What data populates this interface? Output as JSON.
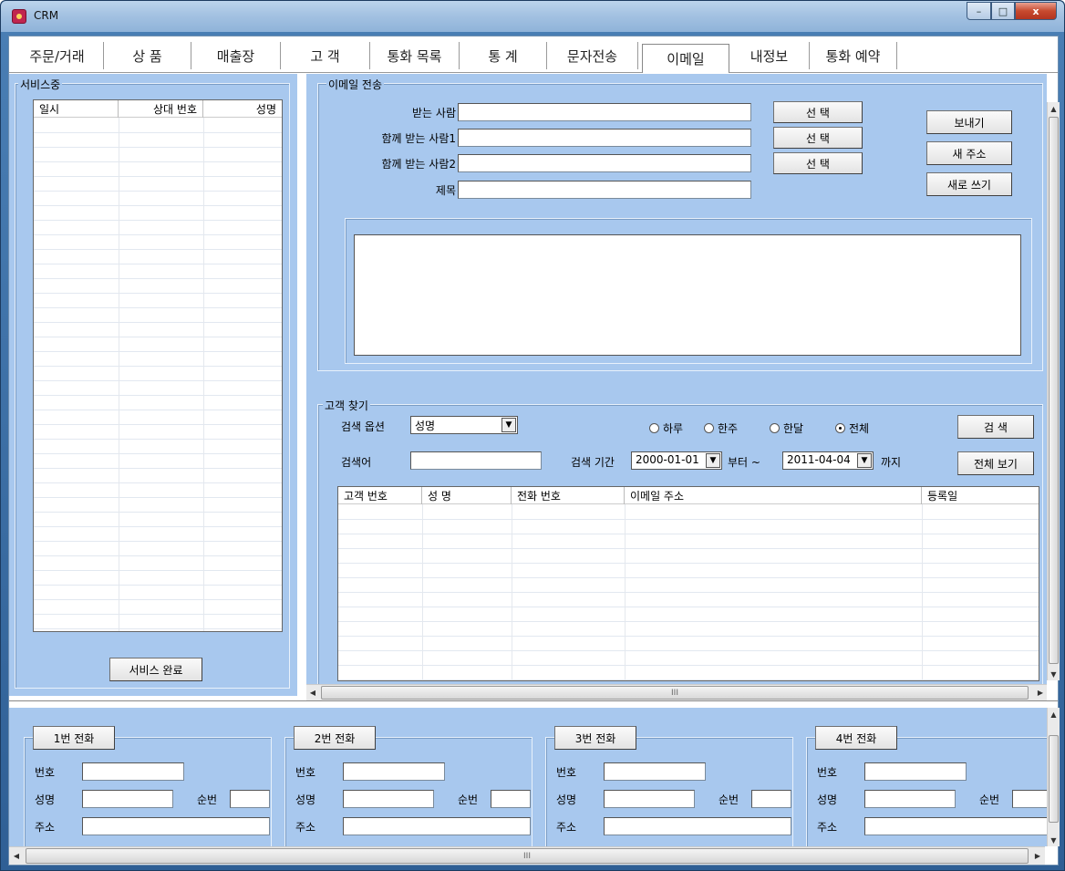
{
  "window": {
    "title": "CRM",
    "min": "–",
    "max": "□",
    "close": "x"
  },
  "tabs": [
    "주문/거래",
    "상 품",
    "매출장",
    "고 객",
    "통화 목록",
    "통 계",
    "문자전송",
    "이메일",
    "내정보",
    "통화 예약"
  ],
  "active_tab": "이메일",
  "service": {
    "group_label": "서비스중",
    "columns": [
      "일시",
      "상대 번호",
      "성명"
    ],
    "done_button": "서비스 완료"
  },
  "email": {
    "group_label": "이메일 전송",
    "to_label": "받는 사람",
    "cc1_label": "함께 받는 사람1",
    "cc2_label": "함께 받는 사람2",
    "subject_label": "제목",
    "select_button": "선 택",
    "send_button": "보내기",
    "new_address_button": "새 주소",
    "rewrite_button": "새로 쓰기"
  },
  "customer_search": {
    "group_label": "고객 찾기",
    "option_label": "검색 옵션",
    "option_value": "성명",
    "keyword_label": "검색어",
    "period_label": "검색 기간",
    "date_from": "2000-01-01",
    "from_suffix": "부터 ~",
    "date_to": "2011-04-04",
    "to_suffix": "까지",
    "radios": [
      "하루",
      "한주",
      "한달",
      "전체"
    ],
    "selected_radio": "전체",
    "search_button": "검 색",
    "view_all_button": "전체 보기",
    "columns": [
      "고객 번호",
      "성 명",
      "전화 번호",
      "이메일 주소",
      "등록일"
    ],
    "hscroll_mark": "III"
  },
  "phones": [
    {
      "title": "1번 전화",
      "number_label": "번호",
      "name_label": "성명",
      "seq_label": "순번",
      "addr_label": "주소"
    },
    {
      "title": "2번 전화",
      "number_label": "번호",
      "name_label": "성명",
      "seq_label": "순번",
      "addr_label": "주소"
    },
    {
      "title": "3번 전화",
      "number_label": "번호",
      "name_label": "성명",
      "seq_label": "순번",
      "addr_label": "주소"
    },
    {
      "title": "4번 전화",
      "number_label": "번호",
      "name_label": "성명",
      "seq_label": "순번",
      "addr_label": "주소"
    }
  ],
  "bottom_hscroll_mark": "III",
  "colors": {
    "panel": "#a8c8ee",
    "title_gradient_top": "#bcd4ec",
    "close": "#c74a2f"
  }
}
